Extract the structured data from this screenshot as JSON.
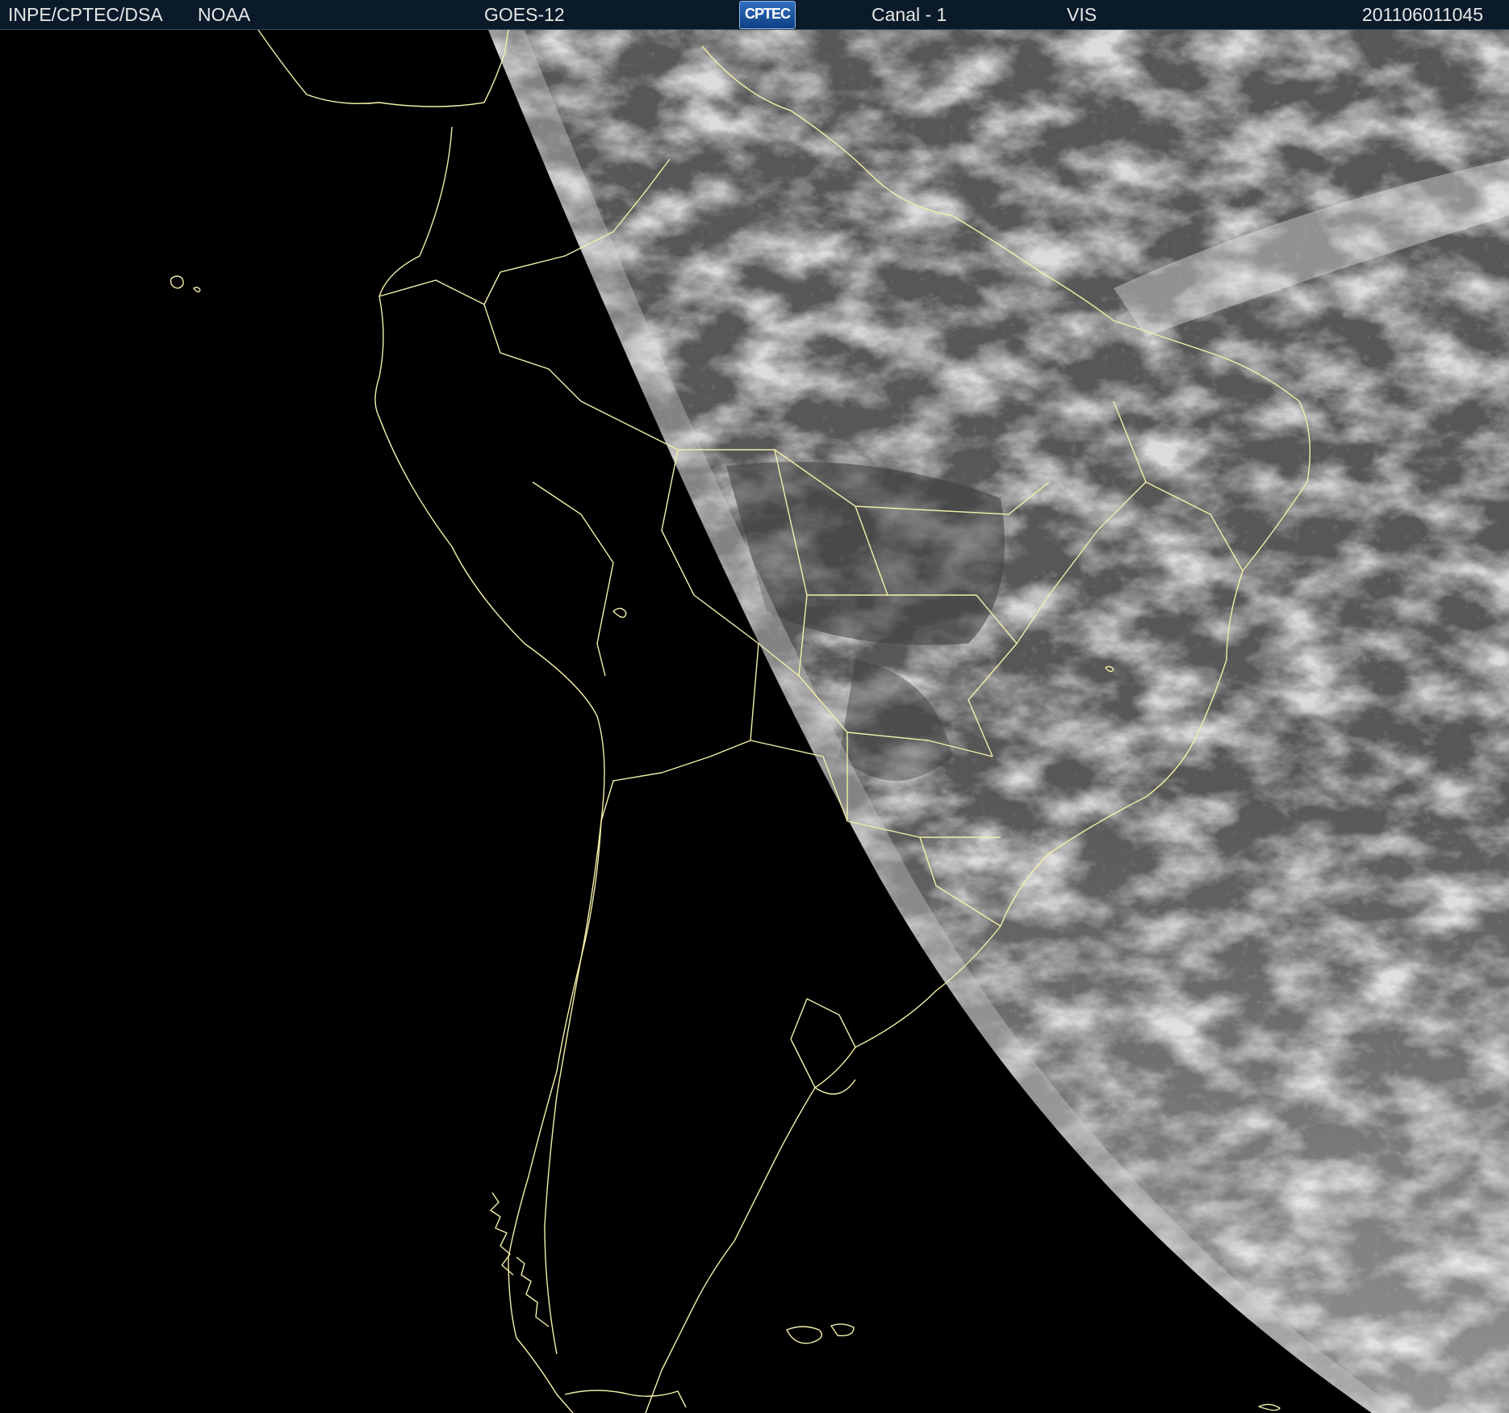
{
  "header": {
    "organization": "INPE/CPTEC/DSA",
    "agency": "NOAA",
    "satellite": "GOES-12",
    "logo_text": "CPTEC",
    "channel": "Canal - 1",
    "band": "VIS",
    "timestamp": "201106011045"
  },
  "map": {
    "background_color": "#000000",
    "border_line_color": "#f2f0a8",
    "daylight_side": "right"
  }
}
